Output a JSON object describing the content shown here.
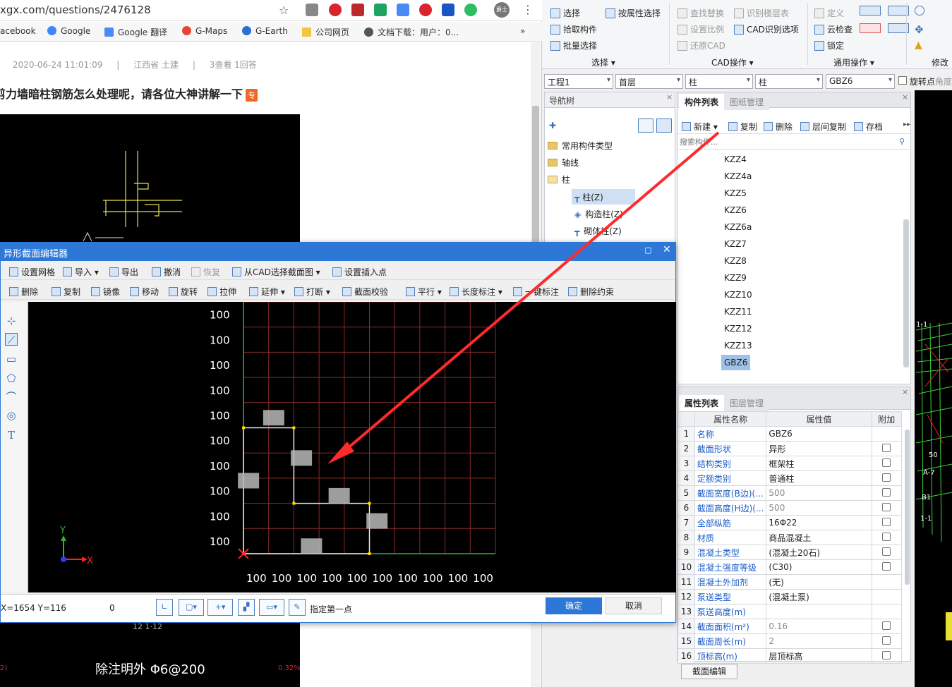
{
  "browser": {
    "url": "xgx.com/questions/2476128",
    "bookmarks": [
      "acebook",
      "Google",
      "Google 翻译",
      "G-Maps",
      "G-Earth",
      "公司网页",
      "文档下载：用户：0..."
    ],
    "more": "»",
    "avatar_label": "爵士",
    "page_meta": "2020-06-24 11:01:09    |    江西省  土建    |    3查看  1回答",
    "meta_date": "2020-06-24 11:01:09",
    "meta_loc": "江西省  土建",
    "meta_stats": "3查看  1回答",
    "question_title": "剪力墙暗柱钢筋怎么处理呢，请各位大神讲解一下",
    "question_tag": "专",
    "cad_bottom_text": "除注明外  Φ6@200",
    "cad_red_left": "2)",
    "cad_red_right": "0.32%"
  },
  "ribbon": {
    "row1": [
      "选择",
      "按属性选择",
      "查找替换",
      "识别楼层表",
      "定义"
    ],
    "row2": [
      "拾取构件",
      "设置比例",
      "CAD识别选项",
      "云检查"
    ],
    "row3": [
      "批量选择",
      "还原CAD",
      "锁定"
    ],
    "groups": [
      "选择 ▾",
      "CAD操作 ▾",
      "通用操作 ▾",
      "修改"
    ]
  },
  "selectors": {
    "project": "工程1",
    "floor": "首层",
    "category": "柱",
    "type": "柱",
    "member": "GBZ6",
    "rotate_label": "旋转点",
    "angle_label": "角度"
  },
  "nav": {
    "title": "导航树",
    "items": [
      "常用构件类型",
      "轴线",
      "柱"
    ],
    "subitems": [
      "柱(Z)",
      "构造柱(Z)",
      "砌体柱(Z)"
    ]
  },
  "components": {
    "tabs": [
      "构件列表",
      "图纸管理"
    ],
    "toolbar": [
      "新建 ▾",
      "复制",
      "删除",
      "层间复制",
      "存档"
    ],
    "search_placeholder": "搜索构件...",
    "items": [
      "KZZ4",
      "KZZ4a",
      "KZZ5",
      "KZZ6",
      "KZZ6a",
      "KZZ7",
      "KZZ8",
      "KZZ9",
      "KZZ10",
      "KZZ11",
      "KZZ12",
      "KZZ13",
      "GBZ6"
    ],
    "selected": "GBZ6"
  },
  "properties": {
    "tabs": [
      "属性列表",
      "图层管理"
    ],
    "headers": [
      "属性名称",
      "属性值",
      "附加"
    ],
    "rows": [
      {
        "n": "1",
        "k": "名称",
        "v": "GBZ6",
        "cb": false
      },
      {
        "n": "2",
        "k": "截面形状",
        "v": "异形",
        "cb": true
      },
      {
        "n": "3",
        "k": "结构类别",
        "v": "框架柱",
        "cb": true
      },
      {
        "n": "4",
        "k": "定额类别",
        "v": "普通柱",
        "cb": true
      },
      {
        "n": "5",
        "k": "截面宽度(B边)(...",
        "v": "500",
        "cb": true,
        "gray": true
      },
      {
        "n": "6",
        "k": "截面高度(H边)(...",
        "v": "500",
        "cb": true,
        "gray": true
      },
      {
        "n": "7",
        "k": "全部纵筋",
        "v": "16Φ22",
        "cb": true
      },
      {
        "n": "8",
        "k": "材质",
        "v": "商品混凝土",
        "cb": true
      },
      {
        "n": "9",
        "k": "混凝土类型",
        "v": "(混凝土20石)",
        "cb": true
      },
      {
        "n": "10",
        "k": "混凝土强度等级",
        "v": "(C30)",
        "cb": true
      },
      {
        "n": "11",
        "k": "混凝土外加剂",
        "v": "(无)",
        "cb": false
      },
      {
        "n": "12",
        "k": "泵送类型",
        "v": "(混凝土泵)",
        "cb": false
      },
      {
        "n": "13",
        "k": "泵送高度(m)",
        "v": "",
        "cb": false
      },
      {
        "n": "14",
        "k": "截面面积(m²)",
        "v": "0.16",
        "cb": true,
        "gray": true
      },
      {
        "n": "15",
        "k": "截面周长(m)",
        "v": "2",
        "cb": true,
        "gray": true
      },
      {
        "n": "16",
        "k": "顶标高(m)",
        "v": "层顶标高",
        "cb": true
      }
    ],
    "edit_button": "截面编辑"
  },
  "dialog": {
    "title": "异形截面编辑器",
    "toolbar1": [
      "设置网格",
      "导入 ▾",
      "导出",
      "撤消",
      "恢复",
      "从CAD选择截面图 ▾",
      "设置插入点"
    ],
    "toolbar2": [
      "删除",
      "复制",
      "镜像",
      "移动",
      "旋转",
      "拉伸",
      "延伸 ▾",
      "打断 ▾",
      "截面校验",
      "平行 ▾",
      "长度标注 ▾",
      "一键标注",
      "删除约束"
    ],
    "grid_label": "100",
    "axis_x": "X",
    "axis_y": "Y",
    "coords": "X=1654 Y=116",
    "angle_value": "0",
    "prompt": "指定第一点",
    "ok": "确定",
    "cancel": "取消"
  },
  "colors": {
    "accent": "#2d78d6",
    "arrow": "#ff2a2a",
    "grid": "#8b2a2a",
    "gridaxis": "#2db52d",
    "shape": "#e8e8e8"
  }
}
